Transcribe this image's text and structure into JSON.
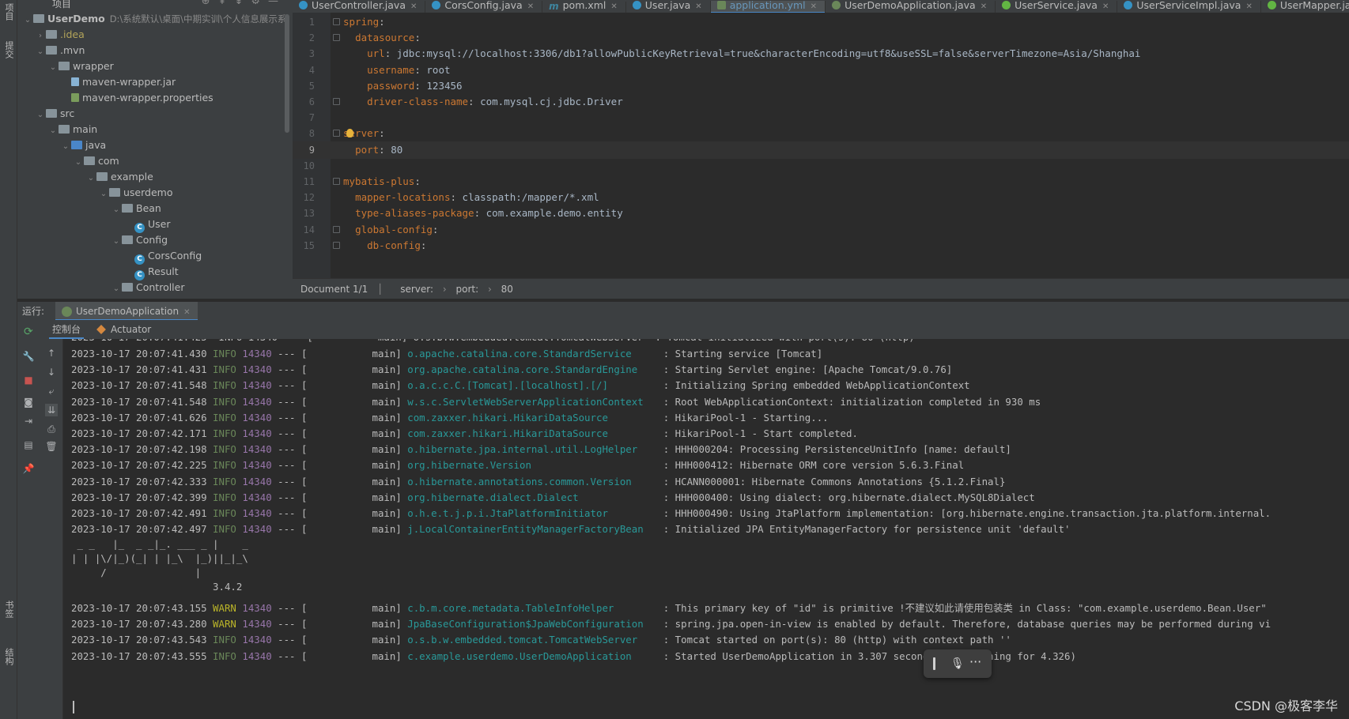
{
  "left_strip": {
    "top_labels": [
      "项目",
      "提交"
    ],
    "bottom_labels": [
      "书签",
      "结构"
    ]
  },
  "project_panel": {
    "title": "项目",
    "root": {
      "name": "UserDemo",
      "path": "D:\\系统默认\\桌面\\中期实训\\个人信息展示系"
    },
    "tree": [
      {
        "label": ".idea",
        "arrow": "›",
        "icon": "folder",
        "dim": true
      },
      {
        "label": ".mvn",
        "arrow": "⌄",
        "icon": "folder"
      },
      {
        "label": "wrapper",
        "arrow": "⌄",
        "icon": "folder"
      },
      {
        "label": "maven-wrapper.jar",
        "arrow": "",
        "icon": "jar-file"
      },
      {
        "label": "maven-wrapper.properties",
        "arrow": "",
        "icon": "properties-file"
      },
      {
        "label": "src",
        "arrow": "⌄",
        "icon": "folder"
      },
      {
        "label": "main",
        "arrow": "⌄",
        "icon": "folder"
      },
      {
        "label": "java",
        "arrow": "⌄",
        "icon": "source-folder"
      },
      {
        "label": "com",
        "arrow": "⌄",
        "icon": "package"
      },
      {
        "label": "example",
        "arrow": "⌄",
        "icon": "package"
      },
      {
        "label": "userdemo",
        "arrow": "⌄",
        "icon": "package"
      },
      {
        "label": "Bean",
        "arrow": "⌄",
        "icon": "package"
      },
      {
        "label": "User",
        "arrow": "",
        "icon": "class"
      },
      {
        "label": "Config",
        "arrow": "⌄",
        "icon": "package"
      },
      {
        "label": "CorsConfig",
        "arrow": "",
        "icon": "class"
      },
      {
        "label": "Result",
        "arrow": "",
        "icon": "class"
      },
      {
        "label": "Controller",
        "arrow": "⌄",
        "icon": "package"
      }
    ]
  },
  "editor_tabs": [
    {
      "label": "UserController.java",
      "icon": "class",
      "active": false
    },
    {
      "label": "CorsConfig.java",
      "icon": "class",
      "active": false
    },
    {
      "label": "pom.xml",
      "icon": "maven",
      "active": false
    },
    {
      "label": "User.java",
      "icon": "class",
      "active": false
    },
    {
      "label": "application.yml",
      "icon": "yml",
      "active": true
    },
    {
      "label": "UserDemoApplication.java",
      "icon": "spring",
      "active": false
    },
    {
      "label": "UserService.java",
      "icon": "interface",
      "active": false
    },
    {
      "label": "UserServiceImpl.java",
      "icon": "class",
      "active": false
    },
    {
      "label": "UserMapper.java",
      "icon": "interface",
      "active": false
    }
  ],
  "editor": {
    "lines": [
      {
        "n": "1",
        "indent": "",
        "key": "spring",
        "val": ""
      },
      {
        "n": "2",
        "indent": "  ",
        "key": "datasource",
        "val": ""
      },
      {
        "n": "3",
        "indent": "    ",
        "key": "url",
        "val": "jdbc:mysql://localhost:3306/db1?allowPublicKeyRetrieval=true&characterEncoding=utf8&useSSL=false&serverTimezone=Asia/Shanghai"
      },
      {
        "n": "4",
        "indent": "    ",
        "key": "username",
        "val": "root"
      },
      {
        "n": "5",
        "indent": "    ",
        "key": "password",
        "val": "123456"
      },
      {
        "n": "6",
        "indent": "    ",
        "key": "driver-class-name",
        "val": "com.mysql.cj.jdbc.Driver"
      },
      {
        "n": "7",
        "indent": "",
        "key": "",
        "val": ""
      },
      {
        "n": "8",
        "indent": "",
        "key": "server",
        "val": ""
      },
      {
        "n": "9",
        "indent": "  ",
        "key": "port",
        "val": "80"
      },
      {
        "n": "10",
        "indent": "",
        "key": "",
        "val": ""
      },
      {
        "n": "11",
        "indent": "",
        "key": "mybatis-plus",
        "val": ""
      },
      {
        "n": "12",
        "indent": "  ",
        "key": "mapper-locations",
        "val": "classpath:/mapper/*.xml"
      },
      {
        "n": "13",
        "indent": "  ",
        "key": "type-aliases-package",
        "val": "com.example.demo.entity"
      },
      {
        "n": "14",
        "indent": "  ",
        "key": "global-config",
        "val": ""
      },
      {
        "n": "15",
        "indent": "    ",
        "key": "db-config",
        "val": ""
      }
    ],
    "current_line": "9"
  },
  "breadcrumb": {
    "doc": "Document 1/1",
    "items": [
      "server:",
      "port:",
      "80"
    ]
  },
  "run_panel": {
    "label": "运行:",
    "tab": "UserDemoApplication",
    "subtabs": [
      "控制台",
      "Actuator"
    ]
  },
  "console": {
    "lines": [
      {
        "ts": "2023-10-17 20:07:41.430",
        "level": "INFO",
        "pid": "14340",
        "thread": "main",
        "logger": "o.apache.catalina.core.StandardService",
        "msg": "Starting service [Tomcat]"
      },
      {
        "ts": "2023-10-17 20:07:41.431",
        "level": "INFO",
        "pid": "14340",
        "thread": "main",
        "logger": "org.apache.catalina.core.StandardEngine",
        "msg": "Starting Servlet engine: [Apache Tomcat/9.0.76]"
      },
      {
        "ts": "2023-10-17 20:07:41.548",
        "level": "INFO",
        "pid": "14340",
        "thread": "main",
        "logger": "o.a.c.c.C.[Tomcat].[localhost].[/]",
        "msg": "Initializing Spring embedded WebApplicationContext"
      },
      {
        "ts": "2023-10-17 20:07:41.548",
        "level": "INFO",
        "pid": "14340",
        "thread": "main",
        "logger": "w.s.c.ServletWebServerApplicationContext",
        "msg": "Root WebApplicationContext: initialization completed in 930 ms"
      },
      {
        "ts": "2023-10-17 20:07:41.626",
        "level": "INFO",
        "pid": "14340",
        "thread": "main",
        "logger": "com.zaxxer.hikari.HikariDataSource",
        "msg": "HikariPool-1 - Starting..."
      },
      {
        "ts": "2023-10-17 20:07:42.171",
        "level": "INFO",
        "pid": "14340",
        "thread": "main",
        "logger": "com.zaxxer.hikari.HikariDataSource",
        "msg": "HikariPool-1 - Start completed."
      },
      {
        "ts": "2023-10-17 20:07:42.198",
        "level": "INFO",
        "pid": "14340",
        "thread": "main",
        "logger": "o.hibernate.jpa.internal.util.LogHelper",
        "msg": "HHH000204: Processing PersistenceUnitInfo [name: default]"
      },
      {
        "ts": "2023-10-17 20:07:42.225",
        "level": "INFO",
        "pid": "14340",
        "thread": "main",
        "logger": "org.hibernate.Version",
        "msg": "HHH000412: Hibernate ORM core version 5.6.3.Final"
      },
      {
        "ts": "2023-10-17 20:07:42.333",
        "level": "INFO",
        "pid": "14340",
        "thread": "main",
        "logger": "o.hibernate.annotations.common.Version",
        "msg": "HCANN000001: Hibernate Commons Annotations {5.1.2.Final}"
      },
      {
        "ts": "2023-10-17 20:07:42.399",
        "level": "INFO",
        "pid": "14340",
        "thread": "main",
        "logger": "org.hibernate.dialect.Dialect",
        "msg": "HHH000400: Using dialect: org.hibernate.dialect.MySQL8Dialect"
      },
      {
        "ts": "2023-10-17 20:07:42.491",
        "level": "INFO",
        "pid": "14340",
        "thread": "main",
        "logger": "o.h.e.t.j.p.i.JtaPlatformInitiator",
        "msg": "HHH000490: Using JtaPlatform implementation: [org.hibernate.engine.transaction.jta.platform.internal."
      },
      {
        "ts": "2023-10-17 20:07:42.497",
        "level": "INFO",
        "pid": "14340",
        "thread": "main",
        "logger": "j.LocalContainerEntityManagerFactoryBean",
        "msg": "Initialized JPA EntityManagerFactory for persistence unit 'default'"
      }
    ],
    "banner": [
      " _ _   |_  _ _|_. ___ _ |    _",
      "| | |\\/|_)(_| | |_\\  |_)||_|_\\",
      "     /               |",
      "                        3.4.2"
    ],
    "lines_after": [
      {
        "ts": "2023-10-17 20:07:43.155",
        "level": "WARN",
        "pid": "14340",
        "thread": "main",
        "logger": "c.b.m.core.metadata.TableInfoHelper",
        "msg": "This primary key of \"id\" is primitive !不建议如此请使用包装类 in Class: \"com.example.userdemo.Bean.User\""
      },
      {
        "ts": "2023-10-17 20:07:43.280",
        "level": "WARN",
        "pid": "14340",
        "thread": "main",
        "logger": "JpaBaseConfiguration$JpaWebConfiguration",
        "msg": "spring.jpa.open-in-view is enabled by default. Therefore, database queries may be performed during vi"
      },
      {
        "ts": "2023-10-17 20:07:43.543",
        "level": "INFO",
        "pid": "14340",
        "thread": "main",
        "logger": "o.s.b.w.embedded.tomcat.TomcatWebServer",
        "msg": "Tomcat started on port(s): 80 (http) with context path ''"
      },
      {
        "ts": "2023-10-17 20:07:43.555",
        "level": "INFO",
        "pid": "14340",
        "thread": "main",
        "logger": "c.example.userdemo.UserDemoApplication",
        "msg": "Started UserDemoApplication in 3.307 seconds (JVM running for 4.326)"
      }
    ],
    "partial_top": "2023-10-17 20:07:41.425  INFO 14340 --- [           main] o.s.b.w.embedded.tomcat.TomcatWebServer  : Tomcat initialized with port(s): 80 (http)"
  },
  "watermark": "CSDN @极客李华",
  "colors": {
    "accent": "#4a88c7",
    "info": "#6a8759",
    "warn": "#bbb529",
    "logger": "#299999",
    "yaml_key": "#cc7832"
  }
}
